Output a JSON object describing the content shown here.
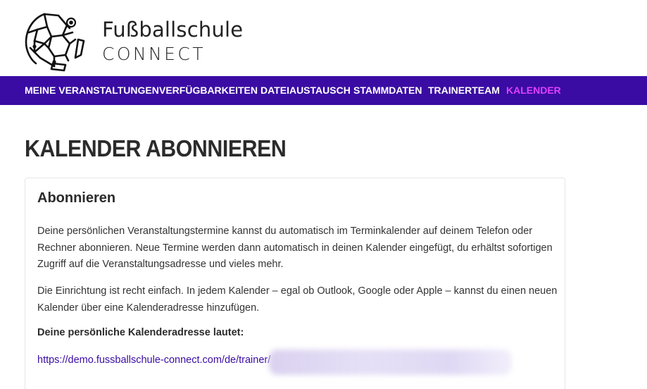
{
  "logo": {
    "line1": "Fußballschule",
    "line2": "CONNECT"
  },
  "nav": {
    "items": [
      {
        "label": "MEINE VERANSTALTUNGEN",
        "active": false
      },
      {
        "label": "VERFÜGBARKEITEN",
        "active": false
      },
      {
        "label": "DATEIAUSTAUSCH",
        "active": false
      },
      {
        "label": "STAMMDATEN",
        "active": false
      },
      {
        "label": "TRAINERTEAM",
        "active": false
      },
      {
        "label": "KALENDER",
        "active": true
      }
    ]
  },
  "page": {
    "title": "KALENDER ABONNIEREN"
  },
  "card": {
    "title": "Abonnieren",
    "paragraph1": "Deine persönlichen Veranstaltungstermine kannst du automatisch im Terminkalender auf deinem Telefon oder Rechner abonnieren. Neue Termine werden dann automatisch in deinen Kalender eingefügt, du erhältst sofortigen Zugriff auf die Veranstaltungsadresse und vieles mehr.",
    "paragraph2": "Die Einrichtung ist recht einfach. In jedem Kalender – egal ob Outlook, Google oder Apple – kannst du einen neuen Kalender über eine Kalenderadresse hinzufügen.",
    "address_label": "Deine persönliche Kalenderadresse lautet:",
    "address_link": "https://demo.fussballschule-connect.com/de/trainer/"
  },
  "colors": {
    "nav_background": "#3a0ca3",
    "nav_active": "#e040fb",
    "link": "#3a0ca3"
  }
}
